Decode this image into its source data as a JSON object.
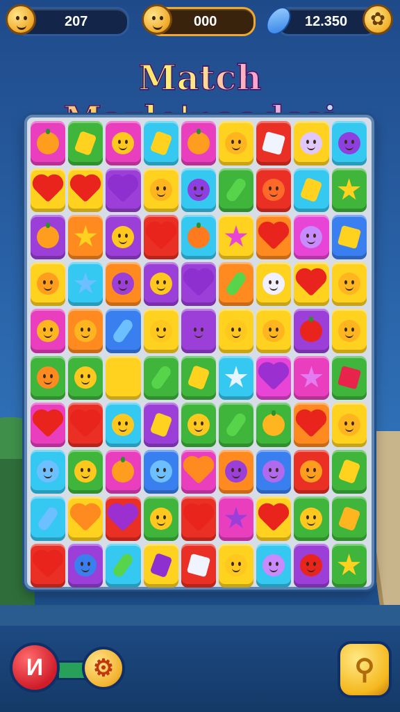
{
  "hud": {
    "lives_value": "207",
    "coins_value": "000",
    "gems_value": "12.350"
  },
  "title": "Match Mazle'naadssi",
  "icons": {
    "menu_button_glyph": "И",
    "settings_glyph": "✿",
    "gear_glyph": "⚙",
    "search_glyph": "⚲"
  },
  "colors": {
    "pink": "#e93fbf",
    "green": "#3fb63b",
    "yellow": "#ffd21f",
    "red": "#ea2f24",
    "purple": "#9b3fd8",
    "cyan": "#35c8f0",
    "orange": "#ff8a1f",
    "blue": "#3a7ff0",
    "lime": "#8ad43a",
    "magenta": "#e844d6"
  },
  "board": [
    [
      [
        "pink",
        "fruit",
        "#ff9d1f"
      ],
      [
        "green",
        "diamond",
        "#ffd21f"
      ],
      [
        "pink",
        "face",
        "#ffc81f"
      ],
      [
        "cyan",
        "diamond",
        "#ffd21f"
      ],
      [
        "pink",
        "fruit",
        "#ff9d1f"
      ],
      [
        "yellow",
        "face",
        "#ffb51f"
      ],
      [
        "red",
        "cube",
        "#f0f4ff"
      ],
      [
        "yellow",
        "face",
        "#e0c8ff"
      ],
      [
        "cyan",
        "face",
        "#8e3fe0"
      ]
    ],
    [
      [
        "yellow",
        "heart",
        "#e8241c"
      ],
      [
        "yellow",
        "heart",
        "#e8241c"
      ],
      [
        "purple",
        "heart",
        "#8e2fd0"
      ],
      [
        "yellow",
        "face",
        "#ffb51f"
      ],
      [
        "cyan",
        "face",
        "#8e3fe0"
      ],
      [
        "green",
        "pickle",
        "#58d44a"
      ],
      [
        "red",
        "face",
        "#ff6a2a"
      ],
      [
        "cyan",
        "diamond",
        "#ffd21f"
      ],
      [
        "green",
        "star",
        "#ffd21f"
      ]
    ],
    [
      [
        "purple",
        "fruit",
        "#ff9d1f"
      ],
      [
        "orange",
        "star",
        "#ffd21f"
      ],
      [
        "purple",
        "face",
        "#ffc81f"
      ],
      [
        "red",
        "heart",
        "#e8241c"
      ],
      [
        "cyan",
        "fruit",
        "#ff7a1f"
      ],
      [
        "yellow",
        "star",
        "#e844d6"
      ],
      [
        "orange",
        "heart",
        "#e8241c"
      ],
      [
        "magenta",
        "face",
        "#c88aff"
      ],
      [
        "blue",
        "cube",
        "#ffd21f"
      ]
    ],
    [
      [
        "yellow",
        "face",
        "#ff9d1f"
      ],
      [
        "cyan",
        "star",
        "#6cc0ff"
      ],
      [
        "orange",
        "face",
        "#9b3fd8"
      ],
      [
        "purple",
        "face",
        "#ffc81f"
      ],
      [
        "purple",
        "heart",
        "#8e2fd0"
      ],
      [
        "orange",
        "pickle",
        "#58d44a"
      ],
      [
        "yellow",
        "face",
        "#f0f0ff"
      ],
      [
        "yellow",
        "heart",
        "#e8241c"
      ],
      [
        "yellow",
        "face",
        "#ffb51f"
      ]
    ],
    [
      [
        "pink",
        "face",
        "#ffb51f"
      ],
      [
        "orange",
        "face",
        "#ffb51f"
      ],
      [
        "blue",
        "pickle",
        "#6cc0ff"
      ],
      [
        "yellow",
        "face",
        "#ffc81f"
      ],
      [
        "purple",
        "face",
        "#9b3fd8"
      ],
      [
        "yellow",
        "face",
        "#ffc81f"
      ],
      [
        "yellow",
        "face",
        "#ffb51f"
      ],
      [
        "purple",
        "fruit",
        "#e8241c"
      ],
      [
        "yellow",
        "face",
        "#ffb51f"
      ]
    ],
    [
      [
        "green",
        "face",
        "#ff8a1f"
      ],
      [
        "green",
        "face",
        "#ffc81f"
      ],
      [
        "yellow",
        "diamond",
        "#ffd21f"
      ],
      [
        "green",
        "pickle",
        "#58d44a"
      ],
      [
        "green",
        "diamond",
        "#ffd21f"
      ],
      [
        "cyan",
        "star",
        "#e8f4ff"
      ],
      [
        "magenta",
        "heart",
        "#9b2fd0"
      ],
      [
        "pink",
        "star",
        "#e57bf0"
      ],
      [
        "green",
        "cube",
        "#e8244c"
      ]
    ],
    [
      [
        "pink",
        "heart",
        "#e8241c"
      ],
      [
        "red",
        "heart",
        "#e8241c"
      ],
      [
        "cyan",
        "face",
        "#ffc81f"
      ],
      [
        "purple",
        "diamond",
        "#ffd21f"
      ],
      [
        "green",
        "face",
        "#ffc81f"
      ],
      [
        "green",
        "pickle",
        "#58d44a"
      ],
      [
        "green",
        "fruit",
        "#ffb51f"
      ],
      [
        "orange",
        "heart",
        "#e8241c"
      ],
      [
        "yellow",
        "face",
        "#ffb51f"
      ]
    ],
    [
      [
        "cyan",
        "face",
        "#6cc0ff"
      ],
      [
        "green",
        "face",
        "#ffc81f"
      ],
      [
        "pink",
        "fruit",
        "#ff9d1f"
      ],
      [
        "blue",
        "face",
        "#6cc0ff"
      ],
      [
        "pink",
        "heart",
        "#ff8a1f"
      ],
      [
        "orange",
        "face",
        "#9b3fd8"
      ],
      [
        "blue",
        "face",
        "#b06af0"
      ],
      [
        "red",
        "face",
        "#ff9d1f"
      ],
      [
        "green",
        "diamond",
        "#ffd21f"
      ]
    ],
    [
      [
        "cyan",
        "pickle",
        "#6cc0ff"
      ],
      [
        "yellow",
        "heart",
        "#ff8a1f"
      ],
      [
        "red",
        "heart",
        "#9b2fd0"
      ],
      [
        "green",
        "face",
        "#ffc81f"
      ],
      [
        "red",
        "heart",
        "#e8241c"
      ],
      [
        "pink",
        "star",
        "#9b3fd8"
      ],
      [
        "yellow",
        "heart",
        "#e8241c"
      ],
      [
        "green",
        "face",
        "#ffc81f"
      ],
      [
        "green",
        "diamond",
        "#ffb51f"
      ]
    ],
    [
      [
        "red",
        "heart",
        "#e8241c"
      ],
      [
        "purple",
        "face",
        "#3a7ff0"
      ],
      [
        "cyan",
        "pickle",
        "#58d44a"
      ],
      [
        "yellow",
        "diamond",
        "#8e2fd0"
      ],
      [
        "red",
        "cube",
        "#f0f4ff"
      ],
      [
        "yellow",
        "face",
        "#ffc81f"
      ],
      [
        "cyan",
        "face",
        "#c88aff"
      ],
      [
        "purple",
        "face",
        "#e8241c"
      ],
      [
        "green",
        "star",
        "#ffd21f"
      ]
    ]
  ]
}
